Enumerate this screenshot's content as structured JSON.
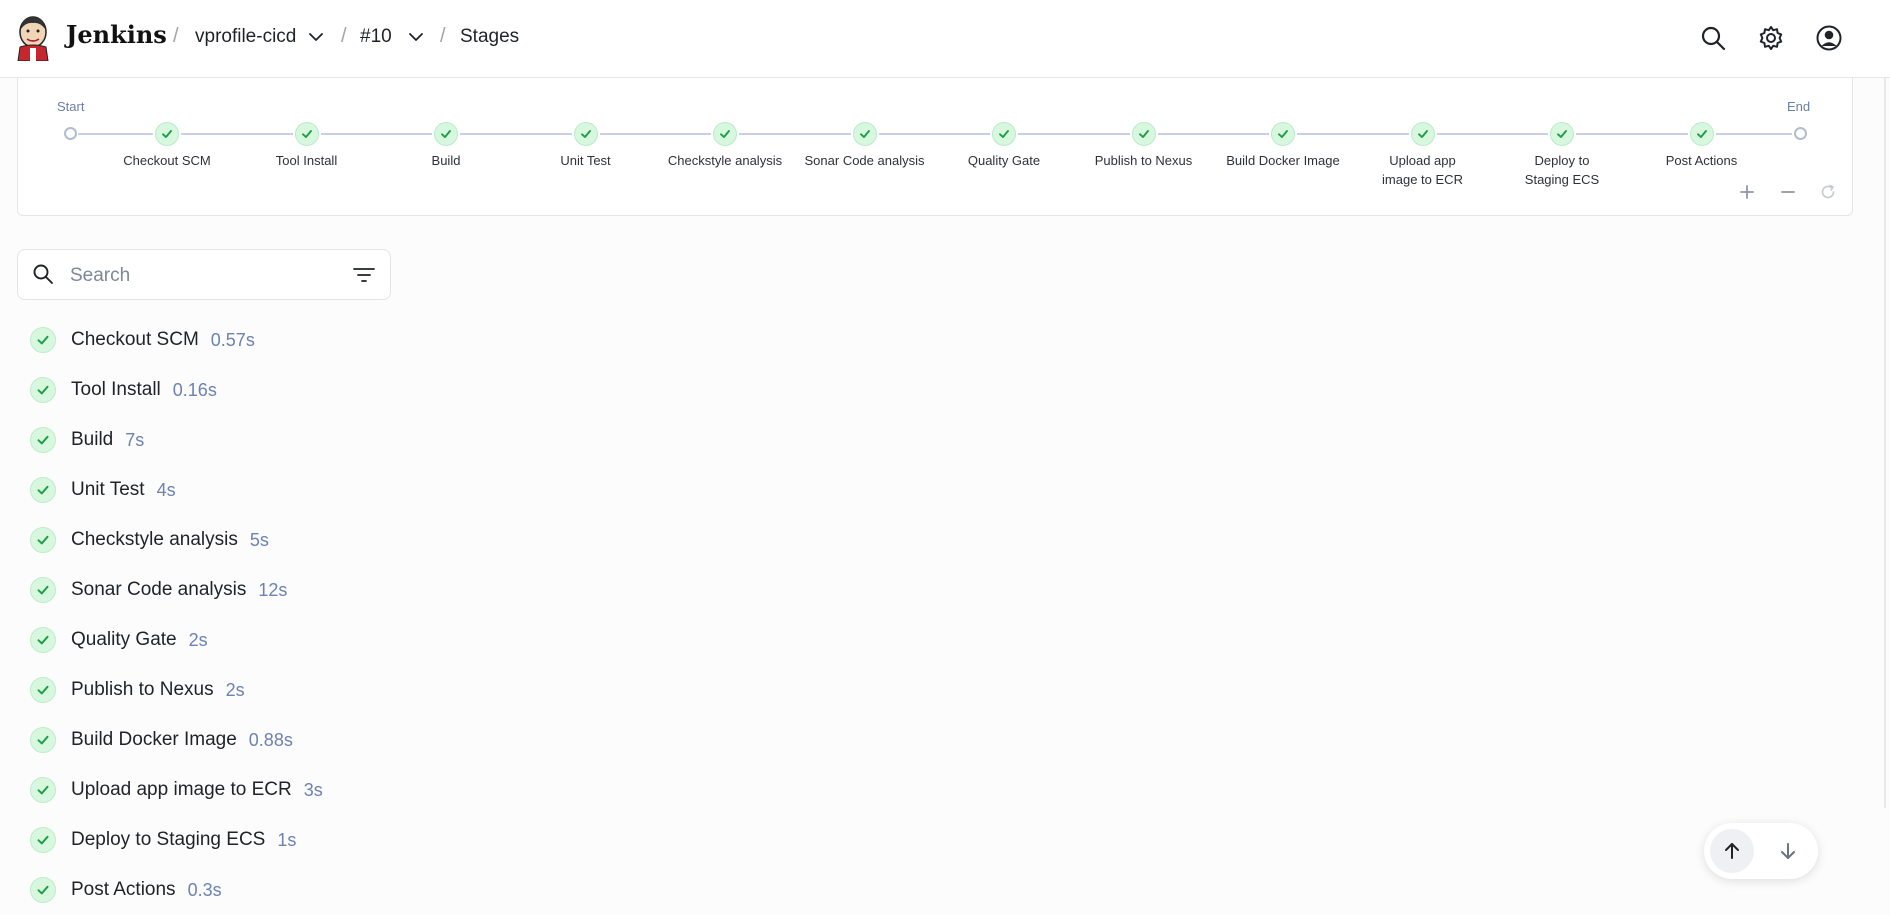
{
  "header": {
    "brand": "Jenkins",
    "breadcrumbs": [
      {
        "label": "vprofile-cicd",
        "has_menu": true
      },
      {
        "label": "#10",
        "has_menu": true
      },
      {
        "label": "Stages",
        "has_menu": false
      }
    ],
    "icons": [
      "search-icon",
      "gear-icon",
      "user-icon"
    ]
  },
  "graph": {
    "start_label": "Start",
    "end_label": "End",
    "stages": [
      "Checkout SCM",
      "Tool Install",
      "Build",
      "Unit Test",
      "Checkstyle analysis",
      "Sonar Code analysis",
      "Quality Gate",
      "Publish to Nexus",
      "Build Docker Image",
      "Upload app image to ECR",
      "Deploy to Staging ECS",
      "Post Actions"
    ],
    "tools": [
      "zoom-in-icon",
      "zoom-out-icon",
      "reset-icon"
    ]
  },
  "search": {
    "placeholder": "Search",
    "value": ""
  },
  "stages": [
    {
      "name": "Checkout SCM",
      "duration": "0.57s",
      "status": "success"
    },
    {
      "name": "Tool Install",
      "duration": "0.16s",
      "status": "success"
    },
    {
      "name": "Build",
      "duration": "7s",
      "status": "success"
    },
    {
      "name": "Unit Test",
      "duration": "4s",
      "status": "success"
    },
    {
      "name": "Checkstyle analysis",
      "duration": "5s",
      "status": "success"
    },
    {
      "name": "Sonar Code analysis",
      "duration": "12s",
      "status": "success"
    },
    {
      "name": "Quality Gate",
      "duration": "2s",
      "status": "success"
    },
    {
      "name": "Publish to Nexus",
      "duration": "2s",
      "status": "success"
    },
    {
      "name": "Build Docker Image",
      "duration": "0.88s",
      "status": "success"
    },
    {
      "name": "Upload app image to ECR",
      "duration": "3s",
      "status": "success"
    },
    {
      "name": "Deploy to Staging ECS",
      "duration": "1s",
      "status": "success"
    },
    {
      "name": "Post Actions",
      "duration": "0.3s",
      "status": "success"
    }
  ],
  "colors": {
    "success_fill": "#d8f7df",
    "success_check": "#1f9e45",
    "duration_text": "#6b82b3",
    "graph_line": "#c7d0e8"
  }
}
